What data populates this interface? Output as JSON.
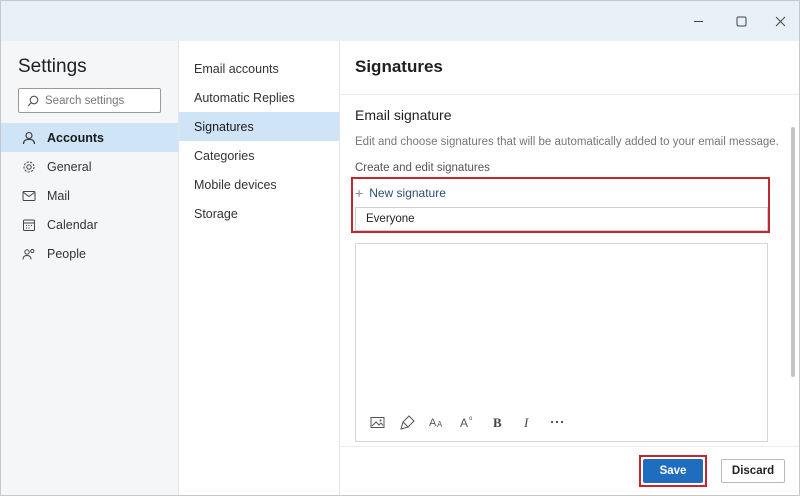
{
  "window": {
    "controls": [
      "minimize-icon",
      "maximize-icon",
      "close-icon"
    ]
  },
  "sidebar": {
    "title": "Settings",
    "search": {
      "placeholder": "Search settings",
      "value": ""
    },
    "items": [
      {
        "label": "Accounts",
        "icon": "person-icon",
        "selected": true
      },
      {
        "label": "General",
        "icon": "gear-icon",
        "selected": false
      },
      {
        "label": "Mail",
        "icon": "mail-icon",
        "selected": false
      },
      {
        "label": "Calendar",
        "icon": "calendar-icon",
        "selected": false
      },
      {
        "label": "People",
        "icon": "people-icon",
        "selected": false
      }
    ]
  },
  "subnav": {
    "items": [
      {
        "label": "Email accounts",
        "selected": false
      },
      {
        "label": "Automatic Replies",
        "selected": false
      },
      {
        "label": "Signatures",
        "selected": true
      },
      {
        "label": "Categories",
        "selected": false
      },
      {
        "label": "Mobile devices",
        "selected": false
      },
      {
        "label": "Storage",
        "selected": false
      }
    ]
  },
  "main": {
    "title": "Signatures",
    "section_title": "Email signature",
    "description": "Edit and choose signatures that will be automatically added to your email message.",
    "subheading": "Create and edit signatures",
    "new_signature_label": "New signature",
    "signature_name": "Everyone",
    "toolbar": [
      "image-icon",
      "format-painter-icon",
      "font-size-icon",
      "superscript-icon",
      "bold-icon",
      "italic-icon",
      "more-icon"
    ]
  },
  "footer": {
    "save_label": "Save",
    "discard_label": "Discard"
  },
  "colors": {
    "accent": "#1f6dbf",
    "selection": "#cfe4f7",
    "highlight": "#c4262e",
    "titlebar": "#e9f1f8"
  }
}
